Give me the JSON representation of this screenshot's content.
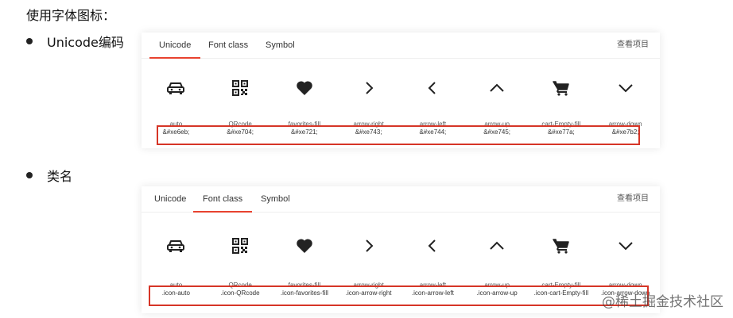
{
  "heading": "使用字体图标：",
  "sections": {
    "unicode_label": "Unicode编码",
    "class_label": "类名"
  },
  "tabs": [
    "Unicode",
    "Font class",
    "Symbol"
  ],
  "view_project": "查看项目",
  "icons": [
    {
      "icon": "car-icon",
      "name": "auto",
      "unicode": "&#xe6eb;",
      "class": ".icon-auto"
    },
    {
      "icon": "qrcode-icon",
      "name": "QRcode",
      "unicode": "&#xe704;",
      "class": ".icon-QRcode"
    },
    {
      "icon": "heart-icon",
      "name": "favorites-fill",
      "unicode": "&#xe721;",
      "class": ".icon-favorites-fill"
    },
    {
      "icon": "arrow-right-icon",
      "name": "arrow-right",
      "unicode": "&#xe743;",
      "class": ".icon-arrow-right"
    },
    {
      "icon": "arrow-left-icon",
      "name": "arrow-left",
      "unicode": "&#xe744;",
      "class": ".icon-arrow-left"
    },
    {
      "icon": "arrow-up-icon",
      "name": "arrow-up",
      "unicode": "&#xe745;",
      "class": ".icon-arrow-up"
    },
    {
      "icon": "cart-icon",
      "name": "cart-Empty-fill",
      "unicode": "&#xe77a;",
      "class": ".icon-cart-Empty-fill"
    },
    {
      "icon": "arrow-down-icon",
      "name": "arrow-down",
      "unicode": "&#xe7b2;",
      "class": ".icon-arrow-down"
    }
  ],
  "watermark": "@稀土掘金技术社区",
  "colors": {
    "accent": "#e8422f",
    "highlight_box": "#d63527"
  }
}
